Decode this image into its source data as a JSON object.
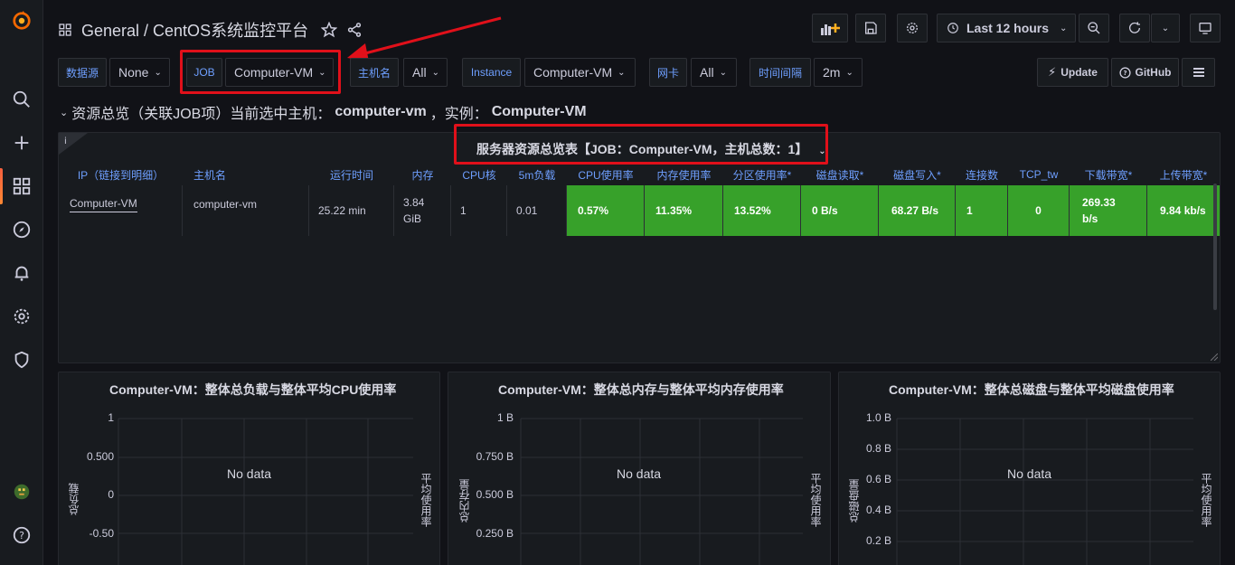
{
  "header": {
    "title": "General / CentOS系统监控平台",
    "time_range": "Last 12 hours"
  },
  "variables": {
    "datasource_label": "数据源",
    "datasource_value": "None",
    "job_label": "JOB",
    "job_value": "Computer-VM",
    "host_label": "主机名",
    "host_value": "All",
    "instance_label": "Instance",
    "instance_value": "Computer-VM",
    "nic_label": "网卡",
    "nic_value": "All",
    "interval_label": "时间间隔",
    "interval_value": "2m"
  },
  "links": {
    "update": "Update",
    "github": "GitHub"
  },
  "row": {
    "prefix": "资源总览（关联JOB项）当前选中主机：",
    "host": "computer-vm",
    "sep": "，实例：",
    "instance": "Computer-VM"
  },
  "table": {
    "title": "服务器资源总览表【JOB：Computer-VM，主机总数：1】",
    "info": "i",
    "headers": [
      "IP（链接到明细）",
      "主机名",
      "运行时间",
      "内存",
      "CPU核",
      "5m负载",
      "CPU使用率",
      "内存使用率",
      "分区使用率*",
      "磁盘读取*",
      "磁盘写入*",
      "连接数",
      "TCP_tw",
      "下载带宽*",
      "上传带宽*"
    ],
    "row": [
      "Computer-VM",
      "computer-vm",
      "25.22 min",
      "3.84 GiB",
      "1",
      "0.01",
      "0.57%",
      "11.35%",
      "13.52%",
      "0 B/s",
      "68.27 B/s",
      "1",
      "0",
      "269.33 b/s",
      "9.84 kb/s"
    ]
  },
  "charts": [
    {
      "title": "Computer-VM：整体总负载与整体平均CPU使用率",
      "nodata": "No data",
      "ylabel": "总负载",
      "y2label": "平均使用率",
      "yticks": [
        "1",
        "0.500",
        "0",
        "-0.50"
      ]
    },
    {
      "title": "Computer-VM：整体总内存与整体平均内存使用率",
      "nodata": "No data",
      "ylabel": "总内存量",
      "y2label": "平均使用率",
      "yticks": [
        "1 B",
        "0.750 B",
        "0.500 B",
        "0.250 B"
      ]
    },
    {
      "title": "Computer-VM：整体总磁盘与整体平均磁盘使用率",
      "nodata": "No data",
      "ylabel": "总磁盘量",
      "y2label": "平均使用率",
      "yticks": [
        "1.0 B",
        "0.8 B",
        "0.6 B",
        "0.4 B",
        "0.2 B"
      ]
    }
  ],
  "colors": {
    "accent": "#6e9fff",
    "green": "#37a12a",
    "highlight": "#e0101a"
  }
}
